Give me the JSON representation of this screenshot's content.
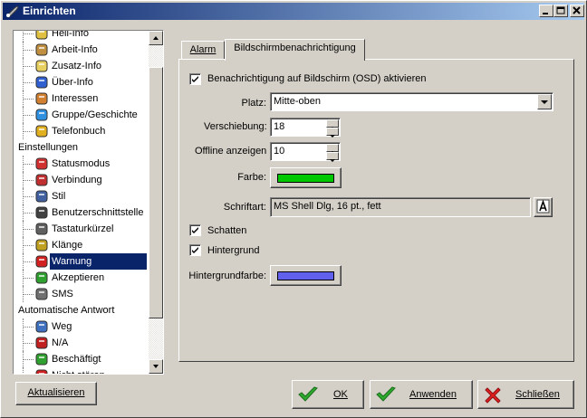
{
  "window": {
    "title": "Einrichten",
    "controls": [
      "_",
      "□",
      "×"
    ]
  },
  "tree": {
    "items": [
      {
        "label": "Hell-Info",
        "kind": "child",
        "icon": "info-icon"
      },
      {
        "label": "Arbeit-Info",
        "kind": "child",
        "icon": "briefcase-icon"
      },
      {
        "label": "Zusatz-Info",
        "kind": "child",
        "icon": "notepad-icon"
      },
      {
        "label": "Über-Info",
        "kind": "child",
        "icon": "info-circle-icon"
      },
      {
        "label": "Interessen",
        "kind": "child",
        "icon": "palette-icon"
      },
      {
        "label": "Gruppe/Geschichte",
        "kind": "child",
        "icon": "group-icon"
      },
      {
        "label": "Telefonbuch",
        "kind": "child",
        "icon": "phone-icon"
      },
      {
        "label": "Einstellungen",
        "kind": "parent"
      },
      {
        "label": "Statusmodus",
        "kind": "child",
        "icon": "status-icon"
      },
      {
        "label": "Verbindung",
        "kind": "child",
        "icon": "connection-icon"
      },
      {
        "label": "Stil",
        "kind": "child",
        "icon": "style-icon"
      },
      {
        "label": "Benutzerschnittstelle",
        "kind": "child",
        "icon": "font-a-icon"
      },
      {
        "label": "Tastaturkürzel",
        "kind": "child",
        "icon": "keyboard-icon"
      },
      {
        "label": "Klänge",
        "kind": "child",
        "icon": "music-icon"
      },
      {
        "label": "Warnung",
        "kind": "child",
        "icon": "warning-icon",
        "selected": true
      },
      {
        "label": "Akzeptieren",
        "kind": "child",
        "icon": "envelope-icon"
      },
      {
        "label": "SMS",
        "kind": "child",
        "icon": "sms-icon"
      },
      {
        "label": "Automatische Antwort",
        "kind": "parent"
      },
      {
        "label": "Weg",
        "kind": "child",
        "icon": "away-icon"
      },
      {
        "label": "N/A",
        "kind": "child",
        "icon": "na-icon"
      },
      {
        "label": "Beschäftigt",
        "kind": "child",
        "icon": "busy-icon"
      },
      {
        "label": "Nicht stören",
        "kind": "child",
        "icon": "dnd-icon"
      }
    ]
  },
  "tabs": [
    {
      "label": "Alarm",
      "active": false
    },
    {
      "label": "Bildschirmbenachrichtigung",
      "active": true
    }
  ],
  "osd": {
    "enable_label": "Benachrichtigung auf Bildschirm (OSD) aktivieren",
    "enable_checked": true,
    "platz_label": "Platz:",
    "platz_value": "Mitte-oben",
    "verschiebung_label": "Verschiebung:",
    "verschiebung_value": "18",
    "offline_label": "Offline anzeigen",
    "offline_value": "10",
    "farbe_label": "Farbe:",
    "farbe_color": "#00c800",
    "schriftart_label": "Schriftart:",
    "schriftart_value": "MS Shell Dlg, 16 pt., fett",
    "schatten_label": "Schatten",
    "schatten_checked": true,
    "hintergrund_label": "Hintergrund",
    "hintergrund_checked": true,
    "hintergrundfarbe_label": "Hintergrundfarbe:",
    "hintergrundfarbe_color": "#6060ec"
  },
  "buttons": {
    "aktualisieren": "Aktualisieren",
    "ok": "OK",
    "anwenden": "Anwenden",
    "schliessen": "Schließen"
  }
}
